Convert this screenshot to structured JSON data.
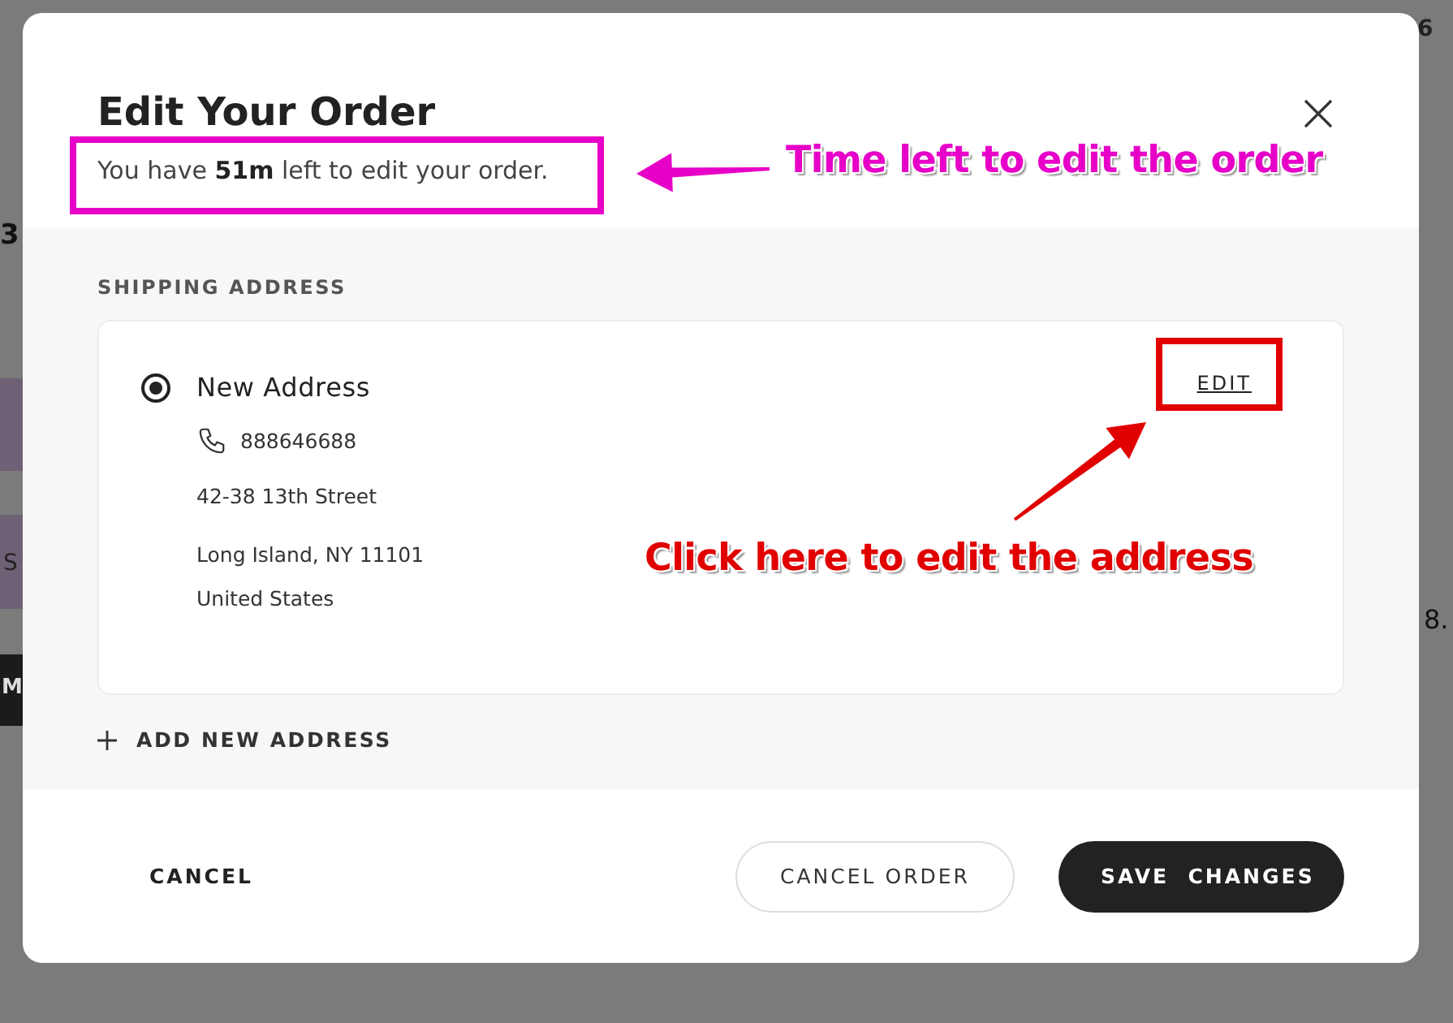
{
  "backdrop": {
    "fragments": [
      {
        "text": "3"
      },
      {
        "text": "S"
      },
      {
        "text": "M"
      },
      {
        "text": "8."
      },
      {
        "text": "6"
      }
    ]
  },
  "dialog": {
    "title": "Edit Your Order",
    "subtitle": "You have **51m** left to edit your order.",
    "section_label": "SHIPPING ADDRESS",
    "addresses": [
      {
        "selected": true,
        "name": "New Address",
        "phone": "888646688",
        "lines": [
          "42-38 13th Street",
          "Long Island, NY 11101",
          "United States"
        ],
        "edit": "EDIT"
      }
    ],
    "add_address": "ADD NEW ADDRESS",
    "buttons": [
      {
        "label": "CANCEL",
        "kind": "text"
      },
      {
        "label": "CANCEL ORDER",
        "kind": "outline"
      },
      {
        "label": "SAVE  CHANGES",
        "kind": "primary"
      }
    ]
  },
  "annotations": [
    {
      "text": "Time left to edit the order",
      "color": "#e600c8"
    },
    {
      "text": "Click here to edit the address",
      "color": "#e00000"
    }
  ]
}
